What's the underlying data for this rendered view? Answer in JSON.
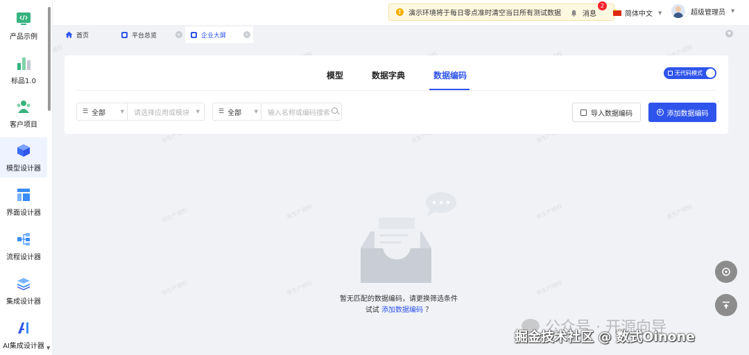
{
  "sidebar": {
    "items": [
      {
        "label": "产品示例",
        "icon": "code-icon"
      },
      {
        "label": "标品1.0",
        "icon": "bar-chart-icon"
      },
      {
        "label": "客户项目",
        "icon": "users-icon"
      },
      {
        "label": "模型设计器",
        "icon": "cube-icon"
      },
      {
        "label": "界面设计器",
        "icon": "layout-icon"
      },
      {
        "label": "流程设计器",
        "icon": "flow-icon"
      },
      {
        "label": "集成设计器",
        "icon": "layers-icon"
      },
      {
        "label": "AI集成设计器",
        "icon": "ai-icon"
      }
    ],
    "active_index": 3
  },
  "topbar": {
    "notice": "演示环境将于每日零点准时清空当日所有测试数据",
    "messages_label": "消息",
    "messages_count": "2",
    "language": "简体中文",
    "user_name": "超级管理员"
  },
  "tabs": [
    {
      "label": "首页"
    },
    {
      "label": "平台总览"
    },
    {
      "label": "企业大屏"
    }
  ],
  "card": {
    "tabs": [
      "模型",
      "数据字典",
      "数据编码"
    ],
    "active_tab": 2,
    "nocode_label": "无代码模式",
    "filter1": {
      "select": "全部",
      "placeholder": "请选择应用或模块"
    },
    "filter2": {
      "select": "全部",
      "placeholder": "输入名称或编码搜索"
    },
    "import_label": "导入数据编码",
    "add_label": "添加数据编码"
  },
  "empty": {
    "line1": "暂无匹配的数据编码，请更换筛选条件",
    "line2_prefix": "试试",
    "line2_link": "添加数据编码",
    "line2_suffix": "？"
  },
  "watermark": "非生产授权",
  "overlay": {
    "line1": "公众号 · 开源向导",
    "line2": "掘金技术社区 @ 数式Oinone"
  },
  "colors": {
    "primary": "#2f54eb",
    "warning": "#f5b000",
    "badge": "#f5222d"
  }
}
